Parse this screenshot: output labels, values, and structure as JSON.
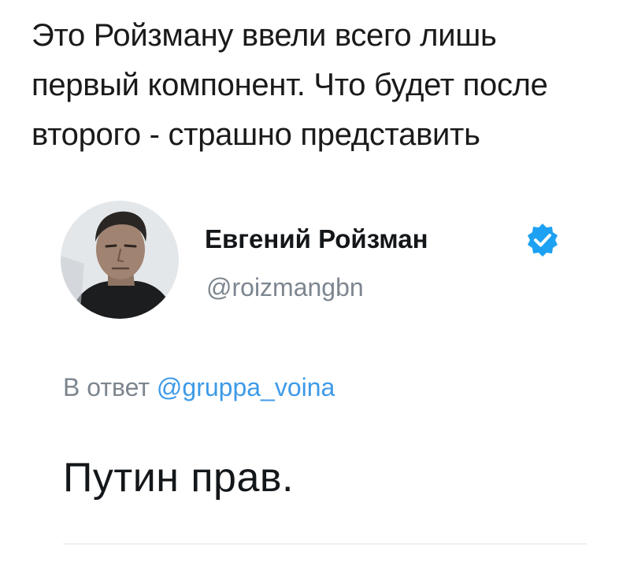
{
  "caption": {
    "lines": [
      "Это Ройзману ввели всего лишь",
      "первый компонент. Что будет после",
      "второго - страшно представить"
    ]
  },
  "tweet": {
    "display_name": "Евгений Ройзман",
    "handle": "@roizmangbn",
    "verified_icon": "verified-badge-icon",
    "reply_prefix": "В ответ",
    "reply_to": "@gruppa_voina",
    "text": "Путин прав.",
    "colors": {
      "link": "#3d9ae8",
      "verified": "#1da1f2",
      "muted": "#7d868f"
    }
  }
}
